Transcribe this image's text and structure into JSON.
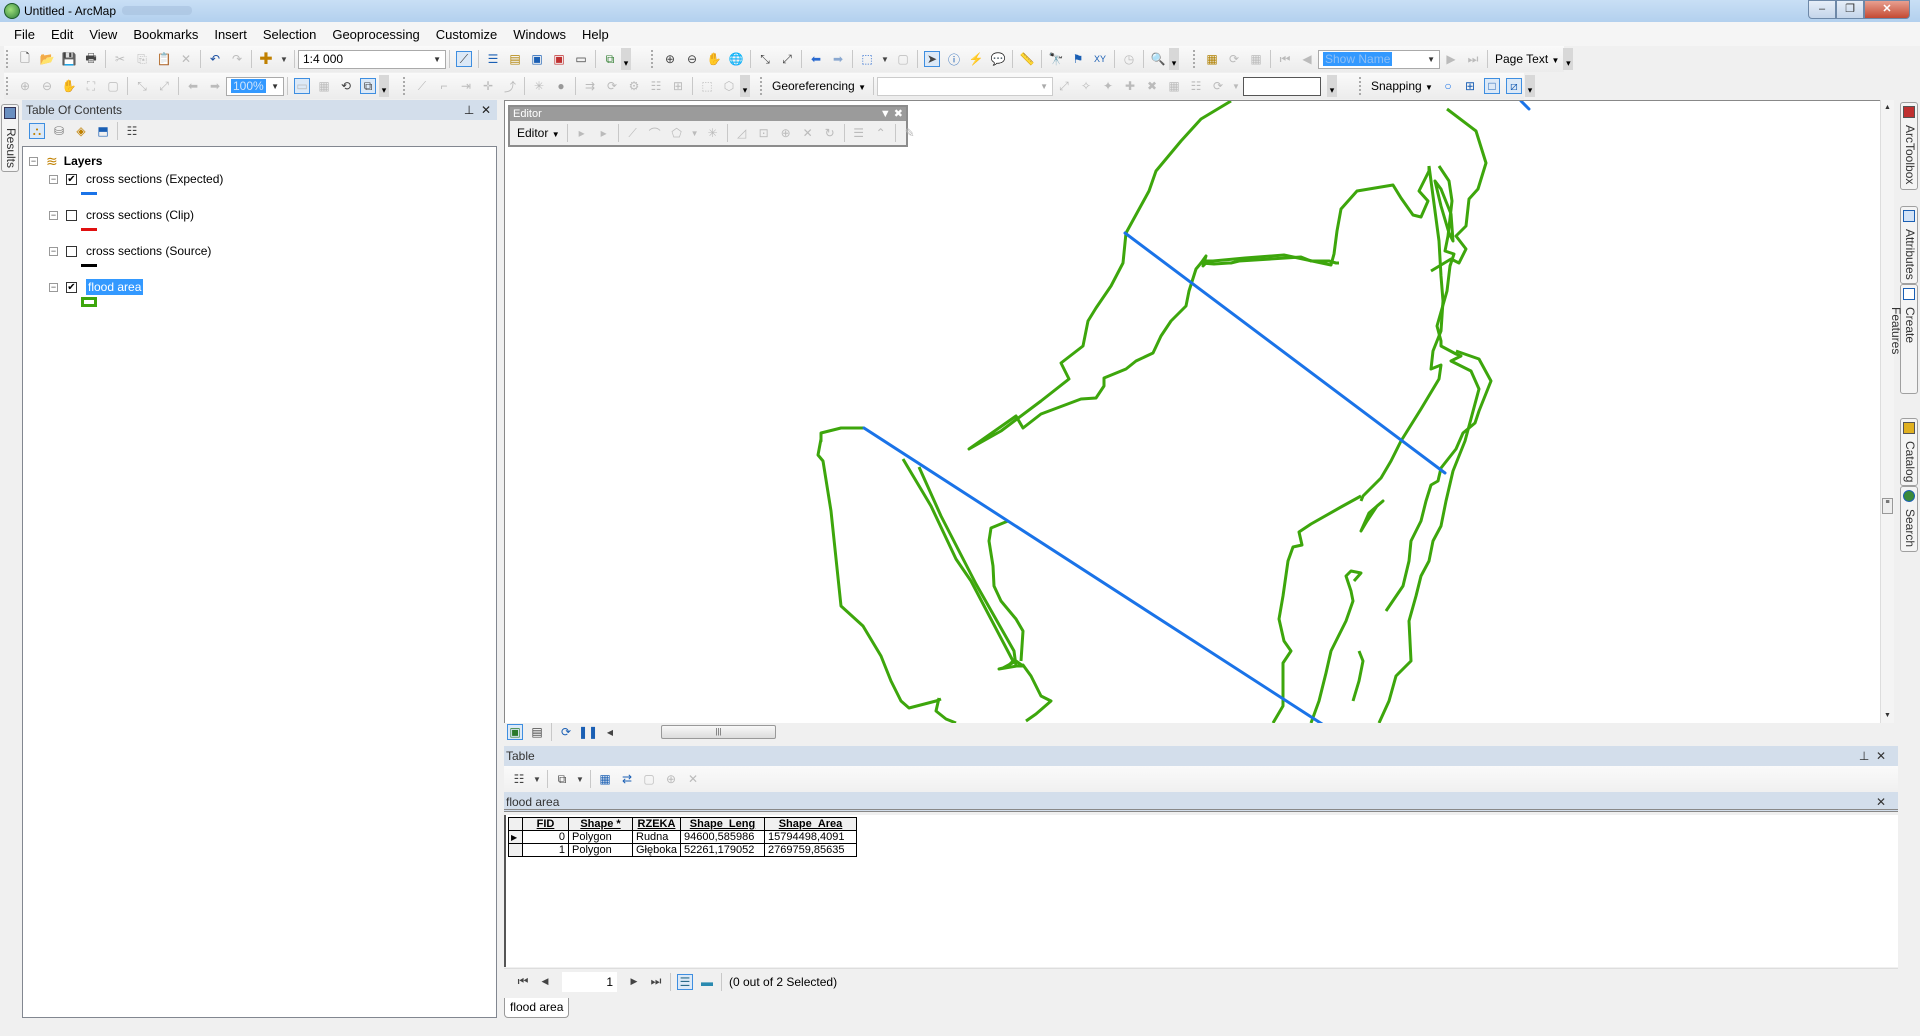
{
  "window": {
    "title": "Untitled - ArcMap",
    "minimize": "–",
    "restore": "❐",
    "close": "✕"
  },
  "menu": [
    "File",
    "Edit",
    "View",
    "Bookmarks",
    "Insert",
    "Selection",
    "Geoprocessing",
    "Customize",
    "Windows",
    "Help"
  ],
  "toolbar": {
    "scale": "1:4 000",
    "layout_zoom": "100%",
    "georeferencing": "Georeferencing",
    "georef_layer": "",
    "show_name": "Show Name",
    "page_text": "Page Text",
    "snapping": "Snapping",
    "georef_value": ""
  },
  "left_tabs": [
    "Results"
  ],
  "right_tabs": [
    "ArcToolbox",
    "Attributes",
    "Create Features",
    "Catalog",
    "Search"
  ],
  "toc": {
    "title": "Table Of Contents",
    "root": "Layers",
    "layers": [
      {
        "name": "cross sections (Expected)",
        "checked": true,
        "symbol_color": "#1a73e8",
        "symbol": "line"
      },
      {
        "name": "cross sections (Clip)",
        "checked": false,
        "symbol_color": "#e01010",
        "symbol": "line"
      },
      {
        "name": "cross sections (Source)",
        "checked": false,
        "symbol_color": "#000000",
        "symbol": "line"
      },
      {
        "name": "flood area",
        "checked": true,
        "symbol_color": "#3da60c",
        "symbol": "polygon",
        "selected": true
      }
    ]
  },
  "editor": {
    "title": "Editor",
    "menu": "Editor"
  },
  "map": {
    "polygon_color": "#3da60c",
    "line_color": "#1a73e8"
  },
  "table": {
    "title": "Table",
    "layer": "flood area",
    "columns": [
      "FID",
      "Shape *",
      "RZEKA",
      "Shape_Leng",
      "Shape_Area"
    ],
    "rows": [
      [
        "0",
        "Polygon",
        "Rudna",
        "94600,585986",
        "15794498,4091"
      ],
      [
        "1",
        "Polygon",
        "Głęboka",
        "52261,179052",
        "2769759,85635"
      ]
    ],
    "current_record": "1",
    "status": "(0 out of 2 Selected)",
    "tab": "flood area"
  }
}
